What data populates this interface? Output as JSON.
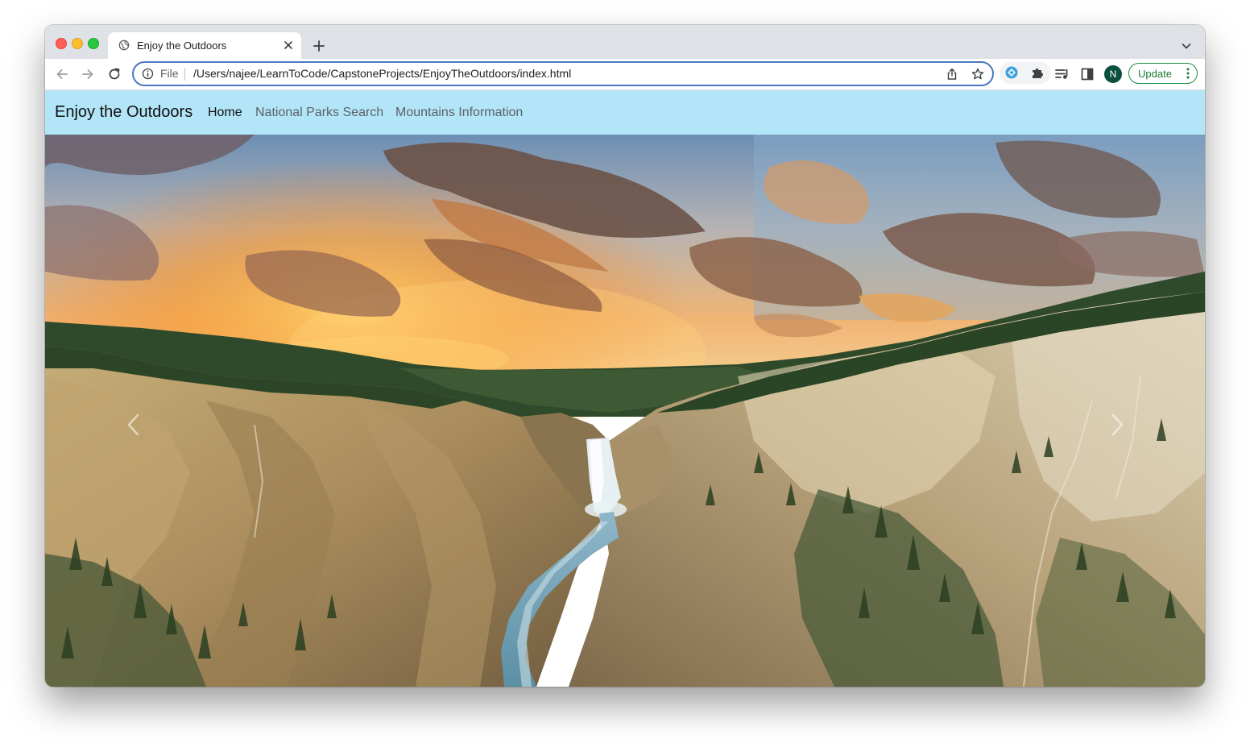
{
  "browser": {
    "tab": {
      "title": "Enjoy the Outdoors",
      "favicon_icon": "globe-icon",
      "close_icon": "close-icon"
    },
    "new_tab_icon": "plus-icon",
    "tab_list_icon": "chevron-down-icon",
    "nav": {
      "back_icon": "arrow-left-icon",
      "forward_icon": "arrow-right-icon",
      "reload_icon": "reload-icon"
    },
    "omnibox": {
      "scheme_label": "File",
      "url": "/Users/najee/LearnToCode/CapstoneProjects/EnjoyTheOutdoors/index.html",
      "info_icon": "info-icon",
      "share_icon": "share-icon",
      "bookmark_icon": "star-icon"
    },
    "extensions": [
      "extension-diamond-icon",
      "puzzle-icon"
    ],
    "reading_list_icon": "reading-list-icon",
    "side_panel_icon": "side-panel-icon",
    "profile_initial": "N",
    "update_button": "Update",
    "menu_icon": "kebab-menu-icon"
  },
  "site": {
    "brand": "Enjoy the Outdoors",
    "nav_links": [
      "Home",
      "National Parks Search",
      "Mountains Information"
    ],
    "active_link": "Home",
    "colors": {
      "navbar_bg": "#b3e5f8",
      "omnibox_focus": "#4a78c2",
      "update_green": "#1e8e3e"
    }
  },
  "carousel": {
    "image_description": "Grand Canyon of the Yellowstone with Lower Falls at sunset",
    "prev_icon": "chevron-left-icon",
    "next_icon": "chevron-right-icon"
  }
}
